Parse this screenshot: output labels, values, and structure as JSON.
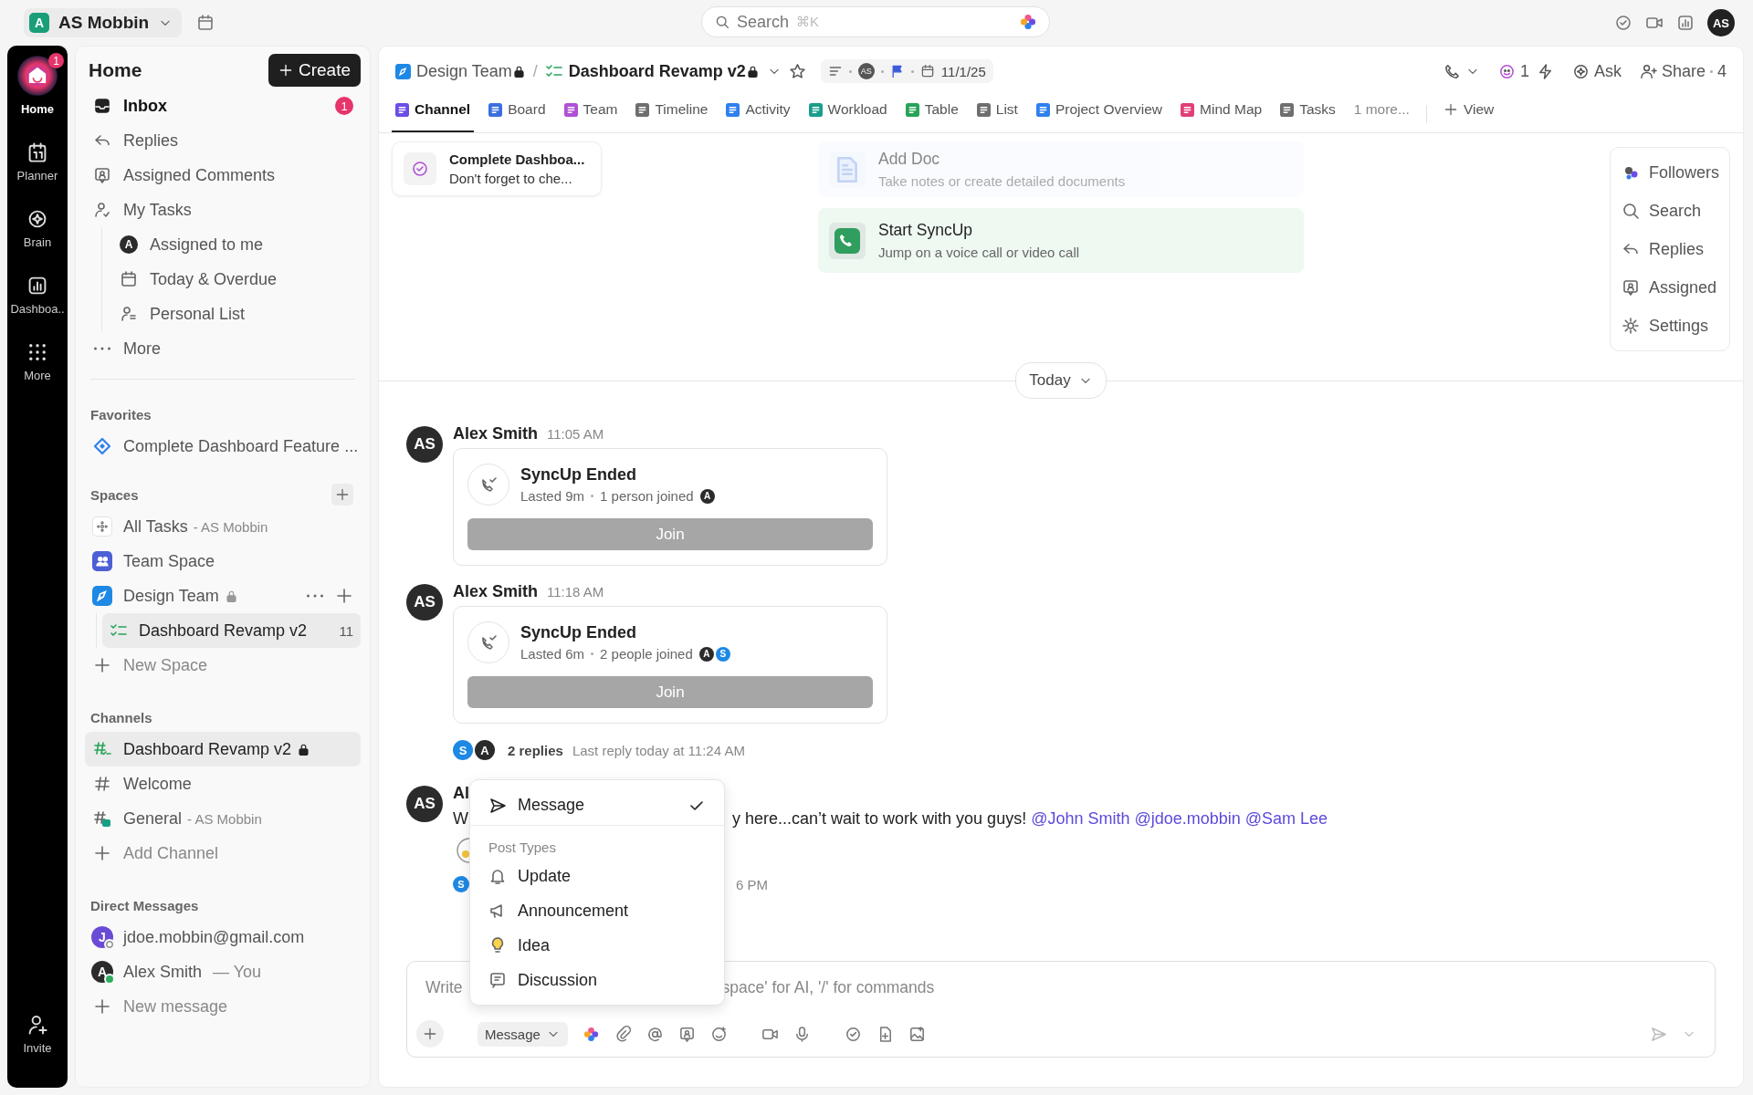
{
  "workspace": {
    "initial": "A",
    "name": "AS Mobbin"
  },
  "search": {
    "placeholder": "Search",
    "shortcut": "⌘K"
  },
  "user_avatar": {
    "initials": "AS"
  },
  "rail": [
    {
      "label": "Home",
      "badge": "1",
      "selected": true
    },
    {
      "label": "Planner",
      "selected": false
    },
    {
      "label": "Brain",
      "selected": false
    },
    {
      "label": "Dashboa..",
      "selected": false
    },
    {
      "label": "More",
      "selected": false
    }
  ],
  "invite": {
    "label": "Invite"
  },
  "sidebar": {
    "title": "Home",
    "create_button": "Create",
    "nav": [
      {
        "label": "Inbox",
        "badge": "1",
        "unread": true
      },
      {
        "label": "Replies",
        "unread": false
      },
      {
        "label": "Assigned Comments",
        "unread": false
      },
      {
        "label": "My Tasks",
        "unread": false,
        "children": [
          {
            "label": "Assigned to me",
            "initial": "A"
          },
          {
            "label": "Today & Overdue"
          },
          {
            "label": "Personal List"
          }
        ]
      },
      {
        "label": "More",
        "unread": false
      }
    ],
    "favorites": {
      "heading": "Favorites",
      "items": [
        {
          "label": "Complete Dashboard Feature ..."
        }
      ]
    },
    "spaces": {
      "heading": "Spaces",
      "items": [
        {
          "label": "All Tasks",
          "suffix": "- AS Mobbin",
          "locked": false
        },
        {
          "label": "Team Space",
          "locked": false
        },
        {
          "label": "Design Team",
          "locked": true,
          "children": [
            {
              "label": "Dashboard Revamp v2",
              "count": "11",
              "selected": true
            }
          ]
        }
      ],
      "add": "New Space"
    },
    "channels": {
      "heading": "Channels",
      "items": [
        {
          "label": "Dashboard Revamp v2",
          "locked": true,
          "selected": true
        },
        {
          "label": "Welcome",
          "locked": false,
          "selected": false
        },
        {
          "label": "General",
          "suffix": "- AS Mobbin",
          "locked": false,
          "selected": false
        }
      ],
      "add": "Add Channel"
    },
    "direct_messages": {
      "heading": "Direct Messages",
      "items": [
        {
          "label": "jdoe.mobbin@gmail.com",
          "initial": "J",
          "color": "#6a4bd6",
          "online": false
        },
        {
          "label": "Alex Smith",
          "suffix": "— You",
          "initial": "A",
          "color": "#2b2b2b",
          "online": true
        }
      ],
      "add": "New message"
    }
  },
  "header": {
    "breadcrumb": [
      {
        "label": "Design Team",
        "locked": true,
        "current": false
      },
      {
        "label": "Dashboard Revamp v2",
        "locked": true,
        "current": true
      }
    ],
    "separator": "/",
    "meta": {
      "avatar": "AS",
      "date": "11/1/25"
    },
    "ai_count": "1",
    "ask": "Ask",
    "share": "Share",
    "share_count": "4"
  },
  "tabs": [
    {
      "label": "Channel",
      "color": "#6b4de6",
      "selected": true
    },
    {
      "label": "Board",
      "color": "#3b6fe0",
      "selected": false
    },
    {
      "label": "Team",
      "color": "#b14fd6",
      "selected": false
    },
    {
      "label": "Timeline",
      "color": "#6e6e6e",
      "selected": false
    },
    {
      "label": "Activity",
      "color": "#2f80ed",
      "selected": false
    },
    {
      "label": "Workload",
      "color": "#1a9e8c",
      "selected": false
    },
    {
      "label": "Table",
      "color": "#27a35a",
      "selected": false
    },
    {
      "label": "List",
      "color": "#6e6e6e",
      "selected": false
    },
    {
      "label": "Project Overview",
      "color": "#2f80ed",
      "selected": false
    },
    {
      "label": "Mind Map",
      "color": "#e0407a",
      "selected": false
    },
    {
      "label": "Tasks",
      "color": "#6e6e6e",
      "selected": false
    }
  ],
  "more_tabs": "1 more...",
  "add_view": "View",
  "pinned_task": {
    "title": "Complete Dashboa...",
    "subtitle": "Don't forget to che..."
  },
  "actions": [
    {
      "kind": "doc",
      "title": "Add Doc",
      "subtitle": "Take notes or create detailed documents",
      "faded": true
    },
    {
      "kind": "syncup",
      "title": "Start SyncUp",
      "subtitle": "Jump on a voice call or video call",
      "faded": false
    }
  ],
  "side_panel": [
    {
      "label": "Followers"
    },
    {
      "label": "Search"
    },
    {
      "label": "Replies"
    },
    {
      "label": "Assigned"
    },
    {
      "label": "Settings"
    }
  ],
  "day_divider": "Today",
  "messages": [
    {
      "kind": "syncup",
      "initials": "AS",
      "author": "Alex Smith",
      "time": "11:05 AM",
      "title": "SyncUp Ended",
      "duration": "Lasted 9m",
      "joined": "1 person joined",
      "participants": [
        {
          "initial": "A",
          "color": "#2b2b2b"
        }
      ],
      "button": "Join"
    },
    {
      "kind": "syncup",
      "initials": "AS",
      "author": "Alex Smith",
      "time": "11:18 AM",
      "title": "SyncUp Ended",
      "duration": "Lasted 6m",
      "joined": "2 people joined",
      "participants": [
        {
          "initial": "A",
          "color": "#2b2b2b"
        },
        {
          "initial": "S",
          "color": "#1e88e5"
        }
      ],
      "button": "Join",
      "thread": {
        "avatars": [
          {
            "initial": "S",
            "color": "#1e88e5"
          },
          {
            "initial": "A",
            "color": "#2b2b2b"
          }
        ],
        "replies": "2 replies",
        "last": "Last reply today at 11:24 AM"
      }
    },
    {
      "kind": "text",
      "initials": "AS",
      "author": "Al",
      "text_start": "W",
      "text_rest": "y here...can’t wait to work with you guys!",
      "mentions": [
        "@John Smith",
        "@jdoe.mobbin",
        "@Sam Lee"
      ],
      "reply_avatar": "S",
      "reply_time": "6 PM"
    }
  ],
  "post_menu": {
    "current": {
      "label": "Message",
      "checked": true
    },
    "heading": "Post Types",
    "items": [
      {
        "label": "Update"
      },
      {
        "label": "Announcement"
      },
      {
        "label": "Idea"
      },
      {
        "label": "Discussion"
      }
    ]
  },
  "composer": {
    "placeholder_start": "Write",
    "placeholder_end": "space' for AI, '/' for commands",
    "type": "Message"
  }
}
